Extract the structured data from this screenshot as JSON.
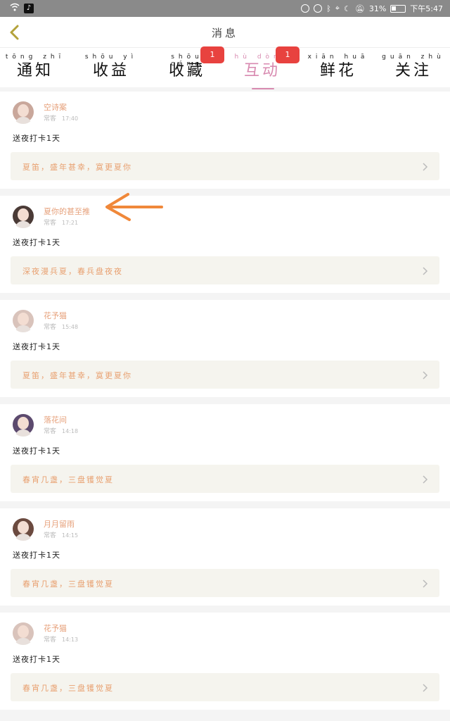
{
  "statusbar": {
    "app_icon": "tiktok-icon",
    "icons": [
      "eye-icon",
      "alarm-icon",
      "bluetooth-icon",
      "location-icon",
      "moon-icon",
      "mute-icon"
    ],
    "battery": "31%",
    "time": "下午5:47"
  },
  "header": {
    "back_icon": "chevron-left-icon",
    "title": "消息"
  },
  "tabs": [
    {
      "pinyin": "tōng zhī",
      "label": "通知",
      "active": false,
      "badge": ""
    },
    {
      "pinyin": "shōu yì",
      "label": "收益",
      "active": false,
      "badge": ""
    },
    {
      "pinyin": "shōu cáng",
      "label": "收藏",
      "active": false,
      "badge": "1"
    },
    {
      "pinyin": "hù dòng",
      "label": "互动",
      "active": true,
      "badge": "1"
    },
    {
      "pinyin": "xiān huā",
      "label": "鲜花",
      "active": false,
      "badge": ""
    },
    {
      "pinyin": "guān zhù",
      "label": "关注",
      "active": false,
      "badge": ""
    }
  ],
  "colors": {
    "accent": "#d88ab0",
    "badge": "#e8423f",
    "username": "#e6a07a",
    "quote_bg": "#f5f4ee"
  },
  "items": [
    {
      "username": "空诗案",
      "role": "常客",
      "time": "17:40",
      "action": "送夜打卡1天",
      "quote": "夏笛，盛年甚幸，寞更夏你",
      "avatar_hair": "#c9a79b"
    },
    {
      "username": "夏你的甚至推",
      "role": "常客",
      "time": "17:21",
      "action": "送夜打卡1天",
      "quote": "深夜漫兵夏，春兵盘夜夜",
      "avatar_hair": "#4a3a36"
    },
    {
      "username": "花予猫",
      "role": "常客",
      "time": "15:48",
      "action": "送夜打卡1天",
      "quote": "夏笛，盛年甚幸，寞更夏你",
      "avatar_hair": "#d9c3bb"
    },
    {
      "username": "落花间",
      "role": "常客",
      "time": "14:18",
      "action": "送夜打卡1天",
      "quote": "春宵几盏，三盘镬觉夏",
      "avatar_hair": "#5c4a6e"
    },
    {
      "username": "月月留雨",
      "role": "常客",
      "time": "14:15",
      "action": "送夜打卡1天",
      "quote": "春宵几盏，三盘镬觉夏",
      "avatar_hair": "#6b4a3f"
    },
    {
      "username": "花予猫",
      "role": "常客",
      "time": "14:13",
      "action": "送夜打卡1天",
      "quote": "春宵几盏，三盘镬觉夏",
      "avatar_hair": "#d9c3bb"
    }
  ]
}
